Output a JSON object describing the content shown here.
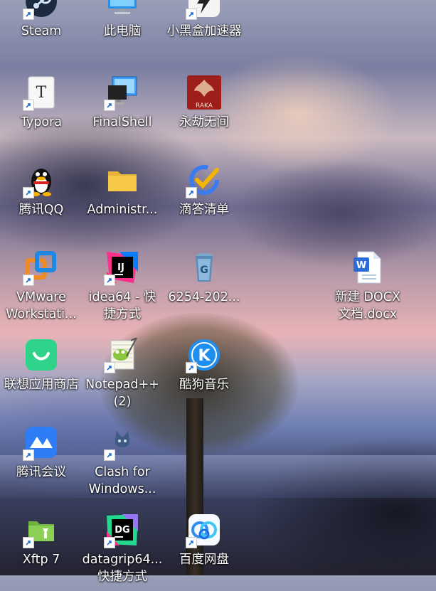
{
  "desktop": {
    "icons": [
      {
        "label": "Steam",
        "icon": "steam-icon",
        "shortcut": true
      },
      {
        "label": "此电脑",
        "icon": "this-pc-icon",
        "shortcut": false
      },
      {
        "label": "小黑盒加速器",
        "icon": "heybox-accelerator-icon",
        "shortcut": true
      },
      {
        "label": "Typora",
        "icon": "typora-icon",
        "shortcut": true
      },
      {
        "label": "FinalShell",
        "icon": "finalshell-icon",
        "shortcut": true
      },
      {
        "label": "永劫无间",
        "icon": "naraka-icon",
        "shortcut": false,
        "logo_text": "RAKA"
      },
      {
        "label": "腾讯QQ",
        "icon": "qq-icon",
        "shortcut": true
      },
      {
        "label": "Administr...",
        "icon": "folder-icon",
        "shortcut": false
      },
      {
        "label": "滴答清单",
        "icon": "ticktick-icon",
        "shortcut": true
      },
      {
        "label": "VMware\nWorkstati...",
        "icon": "vmware-icon",
        "shortcut": true
      },
      {
        "label": "idea64 - 快\n捷方式",
        "icon": "intellij-idea-icon",
        "shortcut": true,
        "logo_text": "IJ"
      },
      {
        "label": "6254-202...",
        "icon": "recycle-archive-icon",
        "shortcut": false
      },
      {
        "label": "新建 DOCX\n文档.docx",
        "icon": "word-document-icon",
        "shortcut": false
      },
      {
        "label": "联想应用商店",
        "icon": "lenovo-app-store-icon",
        "shortcut": false
      },
      {
        "label": "Notepad++\n(2)",
        "icon": "notepad-plus-plus-icon",
        "shortcut": true
      },
      {
        "label": "酷狗音乐",
        "icon": "kugou-music-icon",
        "shortcut": true,
        "logo_text": "K"
      },
      {
        "label": "腾讯会议",
        "icon": "tencent-meeting-icon",
        "shortcut": true
      },
      {
        "label": "Clash for\nWindows...",
        "icon": "clash-icon",
        "shortcut": true
      },
      {
        "label": "Xftp 7",
        "icon": "xftp-icon",
        "shortcut": true
      },
      {
        "label": "datagrip64...\n快捷方式",
        "icon": "datagrip-icon",
        "shortcut": true,
        "logo_text": "DG"
      },
      {
        "label": "百度网盘",
        "icon": "baidu-netdisk-icon",
        "shortcut": true
      }
    ]
  },
  "colors": {
    "label_text": "#ffffff",
    "word_blue": "#2b6cd8",
    "qq_black": "#111111",
    "vmware_orange": "#f08a24",
    "vmware_blue": "#1e88e5",
    "kugou_blue": "#1e8ff0",
    "lenovo_green": "#2fd48a",
    "tencent_meeting_blue": "#2f7df6",
    "naraka_red": "#b3261e",
    "folder_yellow": "#f7c948"
  }
}
